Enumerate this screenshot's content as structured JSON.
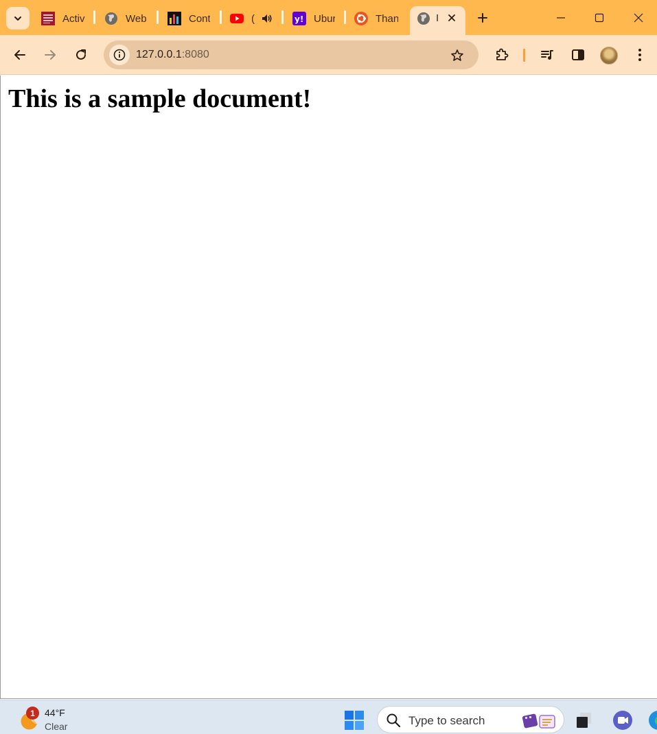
{
  "browser": {
    "tabs": [
      {
        "label": "Activ",
        "icon": "college-logo-icon"
      },
      {
        "label": "Web",
        "icon": "globe-icon"
      },
      {
        "label": "Cont",
        "icon": "bar-chart-app-icon"
      },
      {
        "label": "(",
        "icon": "youtube-icon",
        "audio": true
      },
      {
        "label": "Ubur",
        "icon": "yahoo-icon"
      },
      {
        "label": "Than",
        "icon": "ubuntu-icon"
      }
    ],
    "active_tab": {
      "label": "I",
      "icon": "globe-icon"
    },
    "address": {
      "host": "127.0.0.1",
      "port": ":8080"
    },
    "colors": {
      "frame": "#ffb84d",
      "toolbar": "#fde3c3",
      "omnibox": "#e8c7a2"
    }
  },
  "page": {
    "heading": "This is a sample document!"
  },
  "taskbar": {
    "weather": {
      "badge": "1",
      "temperature": "44°F",
      "condition": "Clear"
    },
    "search_placeholder": "Type to search"
  }
}
